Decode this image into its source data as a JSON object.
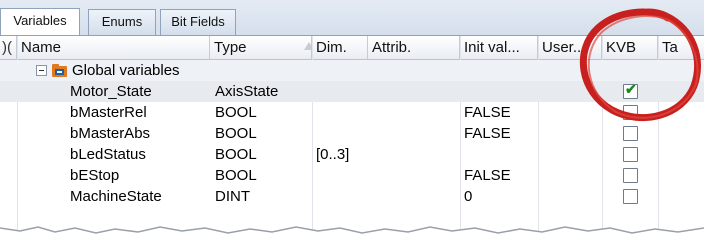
{
  "tabs": [
    {
      "label": "Variables",
      "active": true
    },
    {
      "label": "Enums",
      "active": false
    },
    {
      "label": "Bit Fields",
      "active": false
    }
  ],
  "columns": [
    {
      "label": "Name"
    },
    {
      "label": "Type"
    },
    {
      "label": "Dim."
    },
    {
      "label": "Attrib."
    },
    {
      "label": "Init val..."
    },
    {
      "label": "User..."
    },
    {
      "label": "KVB"
    },
    {
      "label": "Ta"
    }
  ],
  "group": {
    "label": "Global variables",
    "expanded": true
  },
  "rows": [
    {
      "name": "Motor_State",
      "type": "AxisState",
      "dim": "",
      "init": "",
      "kvb": true,
      "selected": true
    },
    {
      "name": "bMasterRel",
      "type": "BOOL",
      "dim": "",
      "init": "FALSE",
      "kvb": false,
      "selected": false
    },
    {
      "name": "bMasterAbs",
      "type": "BOOL",
      "dim": "",
      "init": "FALSE",
      "kvb": false,
      "selected": false
    },
    {
      "name": "bLedStatus",
      "type": "BOOL",
      "dim": "[0..3]",
      "init": "",
      "kvb": false,
      "selected": false
    },
    {
      "name": "bEStop",
      "type": "BOOL",
      "dim": "",
      "init": "FALSE",
      "kvb": false,
      "selected": false
    },
    {
      "name": "MachineState",
      "type": "DINT",
      "dim": "",
      "init": "0",
      "kvb": false,
      "selected": false
    }
  ],
  "colors": {
    "annotation": "#c8201e",
    "check": "#178a1d",
    "tab_border": "#8fa3bf"
  }
}
